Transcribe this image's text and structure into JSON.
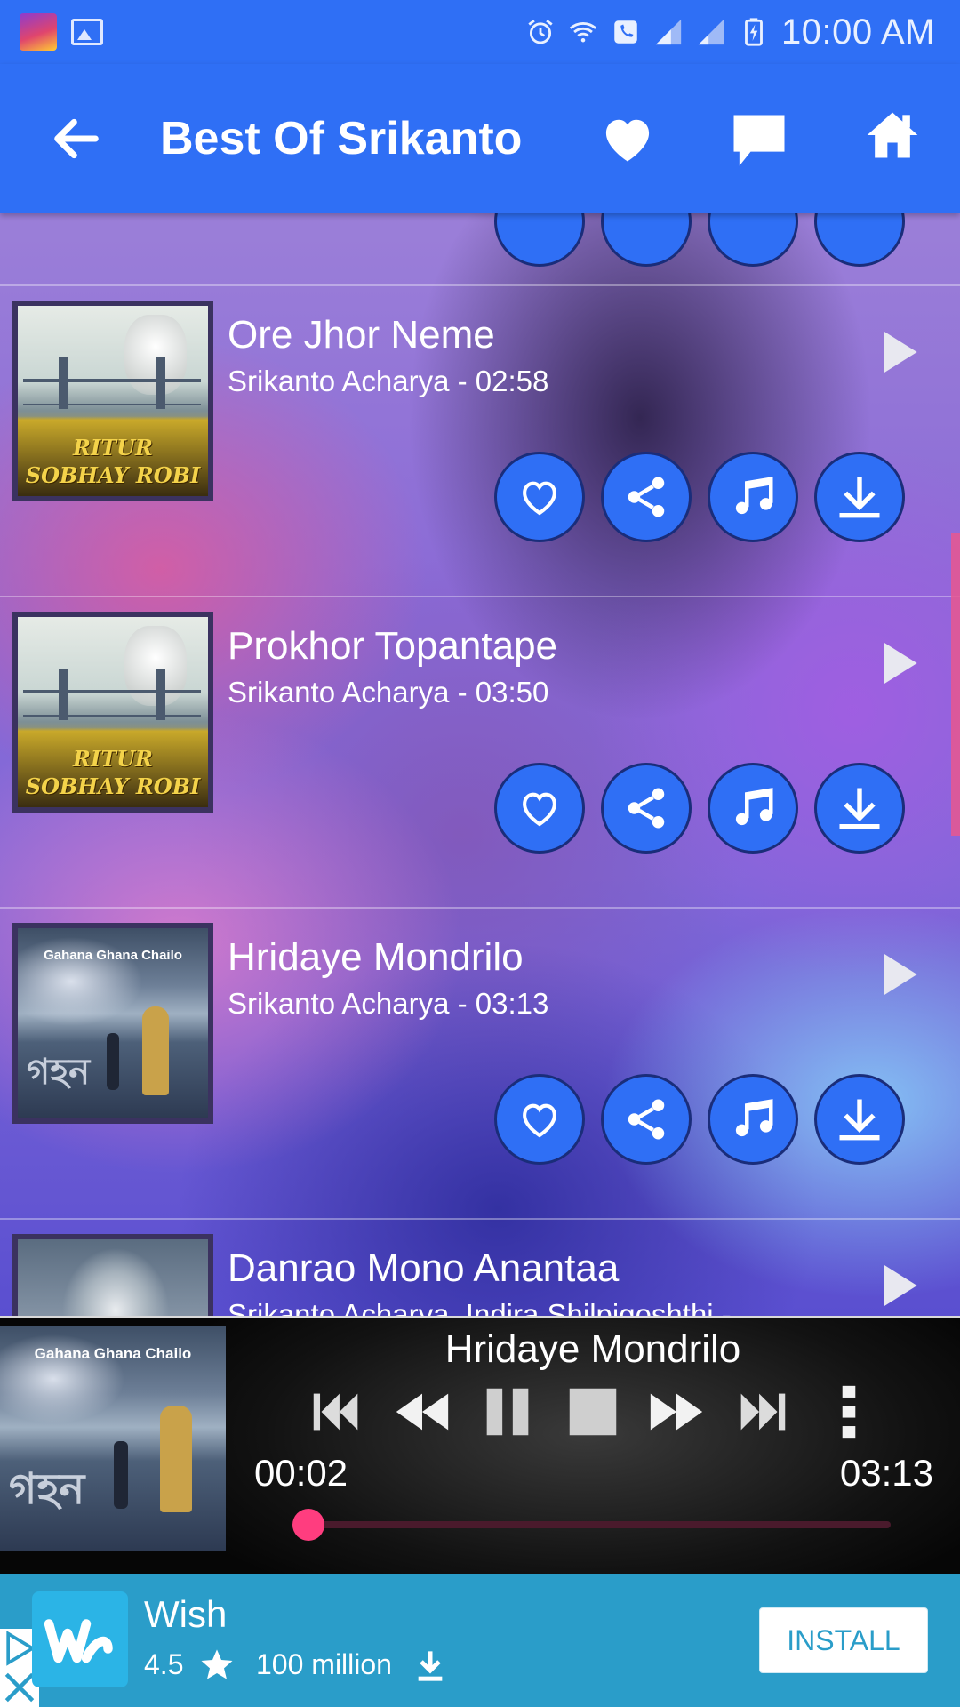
{
  "status_bar": {
    "time": "10:00 AM",
    "icons": [
      "app-notification-icon",
      "image-notification-icon",
      "alarm-icon",
      "wifi-calling-icon",
      "signal-icon",
      "battery-charging-icon"
    ]
  },
  "app_bar": {
    "title": "Best Of Srikanto",
    "actions": [
      "back-arrow-icon",
      "heart-icon",
      "chat-icon",
      "home-icon"
    ]
  },
  "songs": [
    {
      "title": "Ore Jhor Neme",
      "subtitle": "Srikanto Acharya - 02:58",
      "album_art": "ritur-sobhay-robi",
      "album_line1": "RITUR",
      "album_line2": "SOBHAY ROBI"
    },
    {
      "title": "Prokhor Topantape",
      "subtitle": "Srikanto Acharya - 03:50",
      "album_art": "ritur-sobhay-robi",
      "album_line1": "RITUR",
      "album_line2": "SOBHAY ROBI"
    },
    {
      "title": "Hridaye Mondrilo",
      "subtitle": "Srikanto Acharya - 03:13",
      "album_art": "gahana-ghana-chailo",
      "album_caption": "Gahana Ghana Chailo"
    },
    {
      "title": "Danrao Mono Anantaa",
      "subtitle": "Srikanto Acharya, Indira Shilpigoshthi -",
      "album_art": "tagore-portrait"
    }
  ],
  "row_actions": [
    "favorite-icon",
    "share-icon",
    "ringtone-icon",
    "download-icon"
  ],
  "player": {
    "now_playing": "Hridaye Mondrilo",
    "album_caption": "Gahana Ghana Chailo",
    "elapsed": "00:02",
    "total": "03:13",
    "progress": 0.01,
    "controls": [
      "skip-previous-icon",
      "rewind-icon",
      "pause-icon",
      "stop-icon",
      "fast-forward-icon",
      "skip-next-icon",
      "more-vert-icon"
    ]
  },
  "ad": {
    "app_name": "Wish",
    "rating": "4.5",
    "downloads": "100 million",
    "install_label": "INSTALL"
  },
  "colors": {
    "primary": "#2f6ff5",
    "accent": "#ff3d7f",
    "ad_background": "#2a9dc9"
  }
}
